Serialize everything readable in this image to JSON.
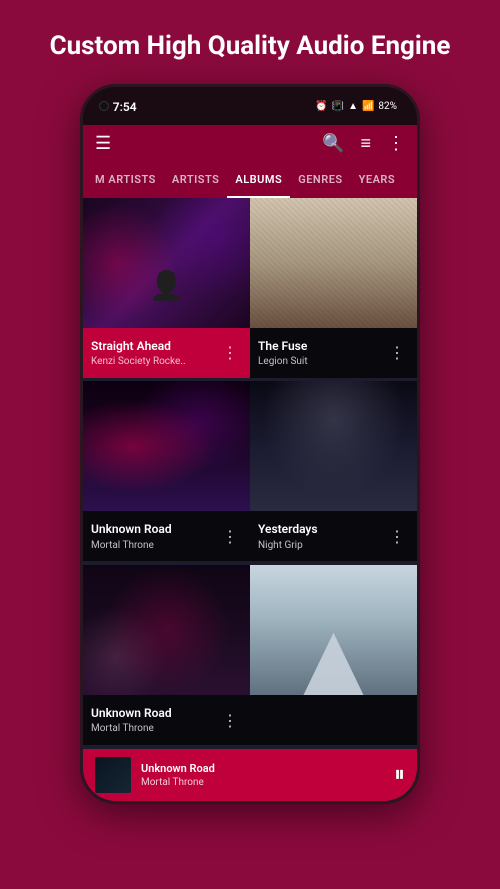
{
  "header": {
    "title": "Custom High Quality Audio Engine"
  },
  "status_bar": {
    "time": "7:54",
    "battery": "82%"
  },
  "toolbar": {
    "menu_icon": "☰",
    "search_icon": "🔍",
    "filter_icon": "≡",
    "more_icon": "⋮"
  },
  "tabs": [
    {
      "label": "M ARTISTS",
      "active": false
    },
    {
      "label": "ARTISTS",
      "active": false
    },
    {
      "label": "ALBUMS",
      "active": true
    },
    {
      "label": "GENRES",
      "active": false
    },
    {
      "label": "YEARS",
      "active": false
    }
  ],
  "albums": [
    {
      "id": "album-1",
      "title": "Straight Ahead",
      "artist": "Kenzi Society Rocke..",
      "highlighted": true,
      "art_class": "art-1"
    },
    {
      "id": "album-2",
      "title": "The Fuse",
      "artist": "Legion Suit",
      "highlighted": false,
      "art_class": "art-2"
    },
    {
      "id": "album-3",
      "title": "Unknown Road",
      "artist": "Mortal Throne",
      "highlighted": false,
      "art_class": "art-3"
    },
    {
      "id": "album-4",
      "title": "Yesterdays",
      "artist": "Night Grip",
      "highlighted": false,
      "art_class": "art-4"
    },
    {
      "id": "album-5",
      "title": "Unknown Road",
      "artist": "Mortal Throne",
      "highlighted": false,
      "art_class": "art-5"
    },
    {
      "id": "album-6",
      "title": "",
      "artist": "",
      "highlighted": false,
      "art_class": "art-6"
    }
  ],
  "now_playing": {
    "title": "Unknown Road",
    "artist": "Mortal Throne",
    "play_pause_icon": "⏸"
  }
}
